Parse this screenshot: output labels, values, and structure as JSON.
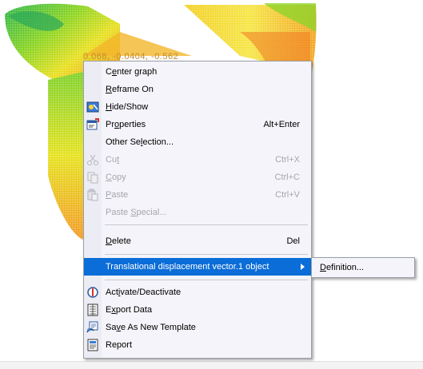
{
  "viewport": {
    "coordinate_text": "0.068, -0.0404, -0.562"
  },
  "context_menu": {
    "items": [
      {
        "label": "Center graph",
        "underline": "e",
        "shortcut": "",
        "icon": "",
        "enabled": true
      },
      {
        "label": "Reframe On",
        "underline": "R",
        "shortcut": "",
        "icon": "",
        "enabled": true
      },
      {
        "label": "Hide/Show",
        "underline": "H",
        "shortcut": "",
        "icon": "hide-show-icon",
        "enabled": true
      },
      {
        "label": "Properties",
        "underline": "o",
        "shortcut": "Alt+Enter",
        "icon": "properties-icon",
        "enabled": true
      },
      {
        "label": "Other Selection...",
        "underline": "l",
        "shortcut": "",
        "icon": "",
        "enabled": true
      },
      {
        "label": "Cut",
        "underline": "t",
        "shortcut": "Ctrl+X",
        "icon": "scissors-icon",
        "enabled": false
      },
      {
        "label": "Copy",
        "underline": "C",
        "shortcut": "Ctrl+C",
        "icon": "copy-icon",
        "enabled": false
      },
      {
        "label": "Paste",
        "underline": "P",
        "shortcut": "Ctrl+V",
        "icon": "paste-icon",
        "enabled": false
      },
      {
        "label": "Paste Special...",
        "underline": "S",
        "shortcut": "",
        "icon": "",
        "enabled": false
      },
      {
        "label": "Delete",
        "underline": "D",
        "shortcut": "Del",
        "icon": "",
        "enabled": true
      },
      {
        "label": "Translational displacement vector.1 object",
        "underline": "",
        "shortcut": "",
        "icon": "",
        "enabled": true,
        "has_submenu": true,
        "highlighted": true
      },
      {
        "label": "Activate/Deactivate",
        "underline": "i",
        "shortcut": "",
        "icon": "activate-deactivate-icon",
        "enabled": true
      },
      {
        "label": "Export Data",
        "underline": "x",
        "shortcut": "",
        "icon": "export-data-icon",
        "enabled": true
      },
      {
        "label": "Save As New Template",
        "underline": "v",
        "shortcut": "",
        "icon": "save-template-icon",
        "enabled": true
      },
      {
        "label": "Report",
        "underline": "",
        "shortcut": "",
        "icon": "report-icon",
        "enabled": true
      }
    ]
  },
  "submenu": {
    "items": [
      {
        "label": "Definition...",
        "underline": "D"
      }
    ]
  },
  "colors": {
    "menu_background": "#f4f4fa",
    "highlight": "#0b6dd8",
    "disabled_text": "#a6a6ad"
  }
}
